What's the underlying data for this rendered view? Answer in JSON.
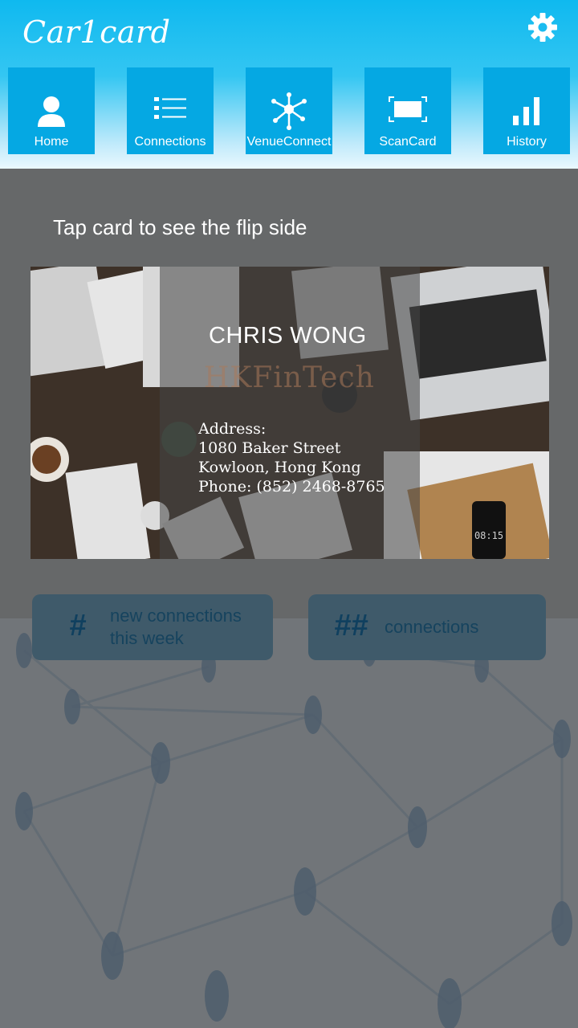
{
  "app": {
    "title": "Car1card",
    "settings_icon": "gear-icon",
    "accent_color": "#05a8e3"
  },
  "nav": {
    "items": [
      {
        "label": "Home",
        "icon": "user-icon"
      },
      {
        "label": "Connections",
        "icon": "list-icon"
      },
      {
        "label": "VenueConnect",
        "icon": "network-icon"
      },
      {
        "label": "ScanCard",
        "icon": "scan-icon"
      },
      {
        "label": "History",
        "icon": "bar-chart-icon"
      }
    ]
  },
  "main": {
    "hint": "Tap card to see the flip side",
    "card": {
      "name": "CHRIS WONG",
      "company": "HKFinTech",
      "address_label": "Address:",
      "address_line1": "1080 Baker Street",
      "address_line2": "Kowloon, Hong Kong",
      "phone": "Phone: (852) 2468-8765"
    },
    "stats": {
      "new_connections_count": "#",
      "new_connections_line1": "new connections",
      "new_connections_line2": "this week",
      "connections_count": "##",
      "connections_label": "connections"
    }
  }
}
